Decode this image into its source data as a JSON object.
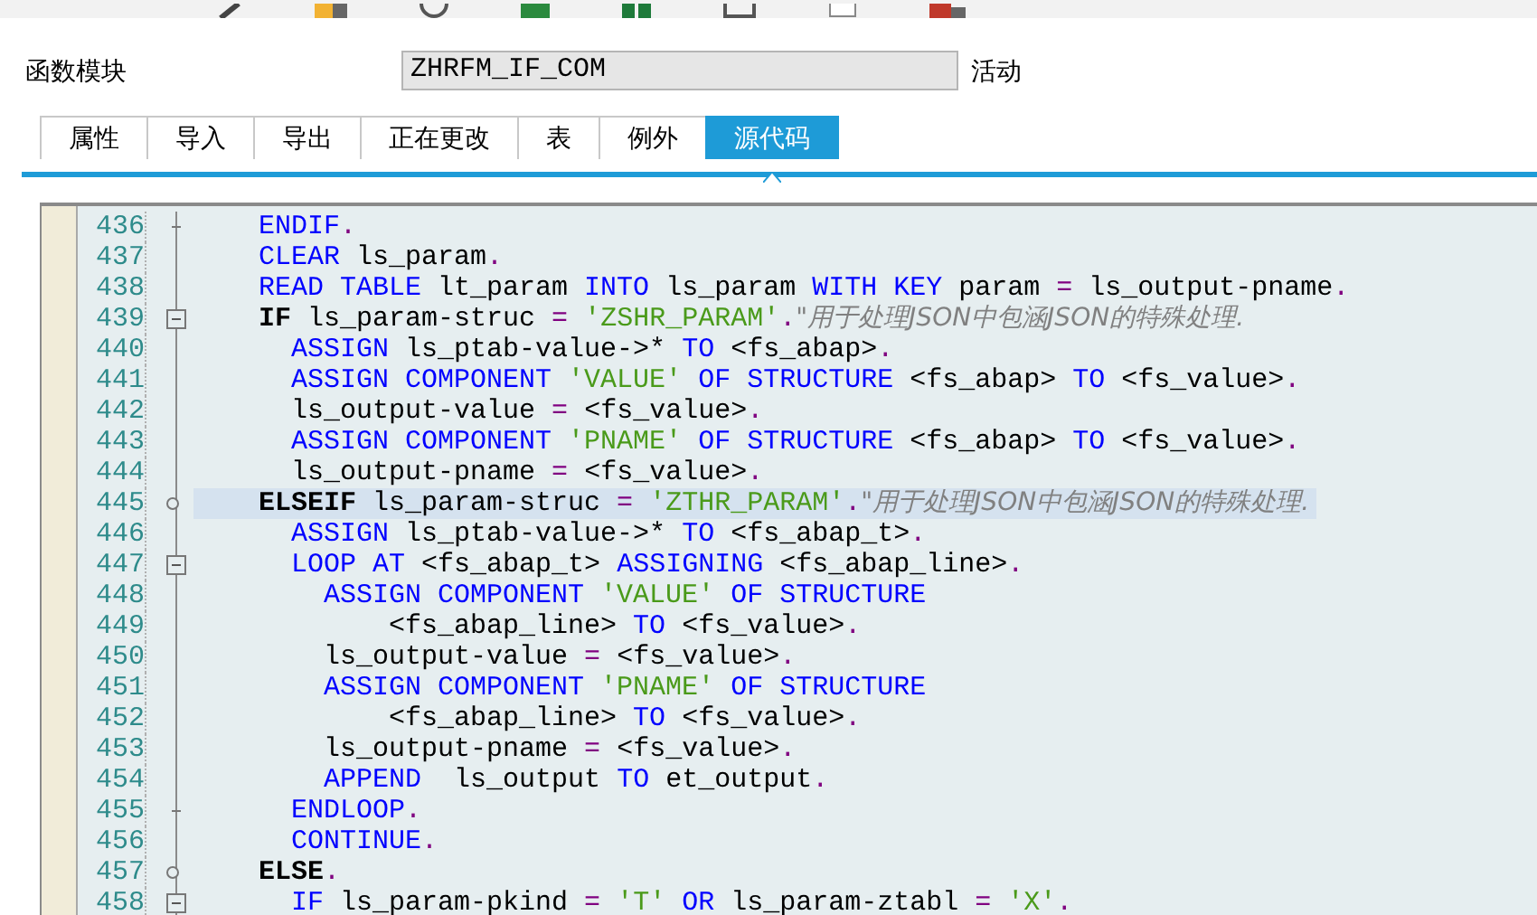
{
  "header": {
    "label": "函数模块",
    "value": "ZHRFM_IF_COM",
    "status": "活动"
  },
  "tabs": [
    {
      "label": "属性",
      "selected": false
    },
    {
      "label": "导入",
      "selected": false
    },
    {
      "label": "导出",
      "selected": false
    },
    {
      "label": "正在更改",
      "selected": false
    },
    {
      "label": "表",
      "selected": false
    },
    {
      "label": "例外",
      "selected": false
    },
    {
      "label": "源代码",
      "selected": true
    }
  ],
  "editor": {
    "lines": [
      {
        "number": "436",
        "kind": "end",
        "current": false,
        "tokens": [
          {
            "kind": "kw",
            "text": "    ENDIF"
          },
          {
            "kind": "op",
            "text": "."
          }
        ]
      },
      {
        "number": "437",
        "kind": "plain",
        "current": false,
        "tokens": [
          {
            "kind": "kw",
            "text": "    CLEAR"
          },
          {
            "kind": "plain",
            "text": " ls_param"
          },
          {
            "kind": "op",
            "text": "."
          }
        ]
      },
      {
        "number": "438",
        "kind": "plain",
        "current": false,
        "tokens": [
          {
            "kind": "kw",
            "text": "    READ TABLE"
          },
          {
            "kind": "plain",
            "text": " lt_param "
          },
          {
            "kind": "kw",
            "text": "INTO"
          },
          {
            "kind": "plain",
            "text": " ls_param "
          },
          {
            "kind": "kw",
            "text": "WITH KEY"
          },
          {
            "kind": "plain",
            "text": " param "
          },
          {
            "kind": "op",
            "text": "="
          },
          {
            "kind": "plain",
            "text": " ls_output-pname"
          },
          {
            "kind": "op",
            "text": "."
          }
        ]
      },
      {
        "number": "439",
        "kind": "fold",
        "current": false,
        "tokens": [
          {
            "kind": "bold",
            "text": "    IF"
          },
          {
            "kind": "plain",
            "text": " ls_param-struc "
          },
          {
            "kind": "op",
            "text": "= "
          },
          {
            "kind": "str",
            "text": "'ZSHR_PARAM'"
          },
          {
            "kind": "op",
            "text": "."
          },
          {
            "kind": "comment",
            "text": "\"用于处理JSON中包涵JSON的特殊处理."
          }
        ]
      },
      {
        "number": "440",
        "kind": "plain",
        "current": false,
        "tokens": [
          {
            "kind": "kw",
            "text": "      ASSIGN"
          },
          {
            "kind": "plain",
            "text": " ls_ptab-value->* "
          },
          {
            "kind": "kw",
            "text": "TO"
          },
          {
            "kind": "plain",
            "text": " <fs_abap>"
          },
          {
            "kind": "op",
            "text": "."
          }
        ]
      },
      {
        "number": "441",
        "kind": "plain",
        "current": false,
        "tokens": [
          {
            "kind": "kw",
            "text": "      ASSIGN COMPONENT "
          },
          {
            "kind": "str",
            "text": "'VALUE' "
          },
          {
            "kind": "kw",
            "text": "OF STRUCTURE"
          },
          {
            "kind": "plain",
            "text": " <fs_abap> "
          },
          {
            "kind": "kw",
            "text": "TO"
          },
          {
            "kind": "plain",
            "text": " <fs_value>"
          },
          {
            "kind": "op",
            "text": "."
          }
        ]
      },
      {
        "number": "442",
        "kind": "plain",
        "current": false,
        "tokens": [
          {
            "kind": "plain",
            "text": "      ls_output-value "
          },
          {
            "kind": "op",
            "text": "="
          },
          {
            "kind": "plain",
            "text": " <fs_value>"
          },
          {
            "kind": "op",
            "text": "."
          }
        ]
      },
      {
        "number": "443",
        "kind": "plain",
        "current": false,
        "tokens": [
          {
            "kind": "kw",
            "text": "      ASSIGN COMPONENT "
          },
          {
            "kind": "str",
            "text": "'PNAME' "
          },
          {
            "kind": "kw",
            "text": "OF STRUCTURE"
          },
          {
            "kind": "plain",
            "text": " <fs_abap> "
          },
          {
            "kind": "kw",
            "text": "TO"
          },
          {
            "kind": "plain",
            "text": " <fs_value>"
          },
          {
            "kind": "op",
            "text": "."
          }
        ]
      },
      {
        "number": "444",
        "kind": "plain",
        "current": false,
        "tokens": [
          {
            "kind": "plain",
            "text": "      ls_output-pname "
          },
          {
            "kind": "op",
            "text": "="
          },
          {
            "kind": "plain",
            "text": " <fs_value>"
          },
          {
            "kind": "op",
            "text": "."
          }
        ]
      },
      {
        "number": "445",
        "kind": "branch",
        "current": true,
        "tokens": [
          {
            "kind": "bold",
            "text": "    ELSEIF"
          },
          {
            "kind": "plain",
            "text": " ls_param-struc "
          },
          {
            "kind": "op",
            "text": "= "
          },
          {
            "kind": "str",
            "text": "'ZTHR_PARAM'"
          },
          {
            "kind": "op",
            "text": "."
          },
          {
            "kind": "comment",
            "text": "\"用于处理JSON中包涵JSON的特殊处理."
          }
        ]
      },
      {
        "number": "446",
        "kind": "plain",
        "current": false,
        "tokens": [
          {
            "kind": "kw",
            "text": "      ASSIGN"
          },
          {
            "kind": "plain",
            "text": " ls_ptab-value->* "
          },
          {
            "kind": "kw",
            "text": "TO"
          },
          {
            "kind": "plain",
            "text": " <fs_abap_t>"
          },
          {
            "kind": "op",
            "text": "."
          }
        ]
      },
      {
        "number": "447",
        "kind": "fold",
        "current": false,
        "tokens": [
          {
            "kind": "kw",
            "text": "      LOOP AT"
          },
          {
            "kind": "plain",
            "text": " <fs_abap_t> "
          },
          {
            "kind": "kw",
            "text": "ASSIGNING"
          },
          {
            "kind": "plain",
            "text": " <fs_abap_line>"
          },
          {
            "kind": "op",
            "text": "."
          }
        ]
      },
      {
        "number": "448",
        "kind": "plain",
        "current": false,
        "tokens": [
          {
            "kind": "kw",
            "text": "        ASSIGN COMPONENT "
          },
          {
            "kind": "str",
            "text": "'VALUE' "
          },
          {
            "kind": "kw",
            "text": "OF STRUCTURE"
          }
        ]
      },
      {
        "number": "449",
        "kind": "plain",
        "current": false,
        "tokens": [
          {
            "kind": "plain",
            "text": "            <fs_abap_line> "
          },
          {
            "kind": "kw",
            "text": "TO"
          },
          {
            "kind": "plain",
            "text": " <fs_value>"
          },
          {
            "kind": "op",
            "text": "."
          }
        ]
      },
      {
        "number": "450",
        "kind": "plain",
        "current": false,
        "tokens": [
          {
            "kind": "plain",
            "text": "        ls_output-value "
          },
          {
            "kind": "op",
            "text": "="
          },
          {
            "kind": "plain",
            "text": " <fs_value>"
          },
          {
            "kind": "op",
            "text": "."
          }
        ]
      },
      {
        "number": "451",
        "kind": "plain",
        "current": false,
        "tokens": [
          {
            "kind": "kw",
            "text": "        ASSIGN COMPONENT "
          },
          {
            "kind": "str",
            "text": "'PNAME' "
          },
          {
            "kind": "kw",
            "text": "OF STRUCTURE"
          }
        ]
      },
      {
        "number": "452",
        "kind": "plain",
        "current": false,
        "tokens": [
          {
            "kind": "plain",
            "text": "            <fs_abap_line> "
          },
          {
            "kind": "kw",
            "text": "TO"
          },
          {
            "kind": "plain",
            "text": " <fs_value>"
          },
          {
            "kind": "op",
            "text": "."
          }
        ]
      },
      {
        "number": "453",
        "kind": "plain",
        "current": false,
        "tokens": [
          {
            "kind": "plain",
            "text": "        ls_output-pname "
          },
          {
            "kind": "op",
            "text": "="
          },
          {
            "kind": "plain",
            "text": " <fs_value>"
          },
          {
            "kind": "op",
            "text": "."
          }
        ]
      },
      {
        "number": "454",
        "kind": "plain",
        "current": false,
        "tokens": [
          {
            "kind": "kw",
            "text": "        APPEND"
          },
          {
            "kind": "plain",
            "text": "  ls_output "
          },
          {
            "kind": "kw",
            "text": "TO"
          },
          {
            "kind": "plain",
            "text": " et_output"
          },
          {
            "kind": "op",
            "text": "."
          }
        ]
      },
      {
        "number": "455",
        "kind": "end",
        "current": false,
        "tokens": [
          {
            "kind": "kw",
            "text": "      ENDLOOP"
          },
          {
            "kind": "op",
            "text": "."
          }
        ]
      },
      {
        "number": "456",
        "kind": "plain",
        "current": false,
        "tokens": [
          {
            "kind": "kw",
            "text": "      CONTINUE"
          },
          {
            "kind": "op",
            "text": "."
          }
        ]
      },
      {
        "number": "457",
        "kind": "branch",
        "current": false,
        "tokens": [
          {
            "kind": "bold",
            "text": "    ELSE"
          },
          {
            "kind": "op",
            "text": "."
          }
        ]
      },
      {
        "number": "458",
        "kind": "fold",
        "current": false,
        "tokens": [
          {
            "kind": "kw",
            "text": "      IF"
          },
          {
            "kind": "plain",
            "text": " ls_param-pkind "
          },
          {
            "kind": "op",
            "text": "= "
          },
          {
            "kind": "str",
            "text": "'T' "
          },
          {
            "kind": "kw",
            "text": "OR"
          },
          {
            "kind": "plain",
            "text": " ls_param-ztabl "
          },
          {
            "kind": "op",
            "text": "= "
          },
          {
            "kind": "str",
            "text": "'X'"
          },
          {
            "kind": "op",
            "text": "."
          }
        ]
      }
    ]
  }
}
